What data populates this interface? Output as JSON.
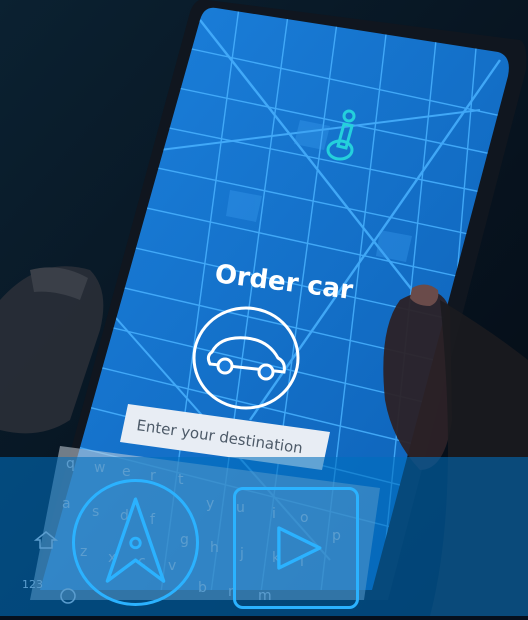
{
  "screen": {
    "title": "Order car",
    "destination_placeholder": "Enter your destination"
  },
  "keyboard": {
    "row1": [
      "q",
      "w",
      "e",
      "r",
      "t",
      "y",
      "u",
      "i",
      "o",
      "p"
    ],
    "row2": [
      "a",
      "s",
      "d",
      "f",
      "g",
      "h",
      "j",
      "k",
      "l"
    ],
    "row3": [
      "z",
      "x",
      "c",
      "v",
      "b",
      "n",
      "m"
    ],
    "row4_left": "123"
  },
  "overlay_buttons": [
    {
      "name": "navigation-arrow",
      "icon": "navigation-arrow-icon"
    },
    {
      "name": "play",
      "icon": "play-icon"
    }
  ],
  "colors": {
    "map_blue": "#1577cf",
    "road_line": "#49b2ff",
    "accent_cyan": "#24d0dc",
    "overlay_blue": "#006ebe",
    "button_outline": "#2bb2ff"
  }
}
